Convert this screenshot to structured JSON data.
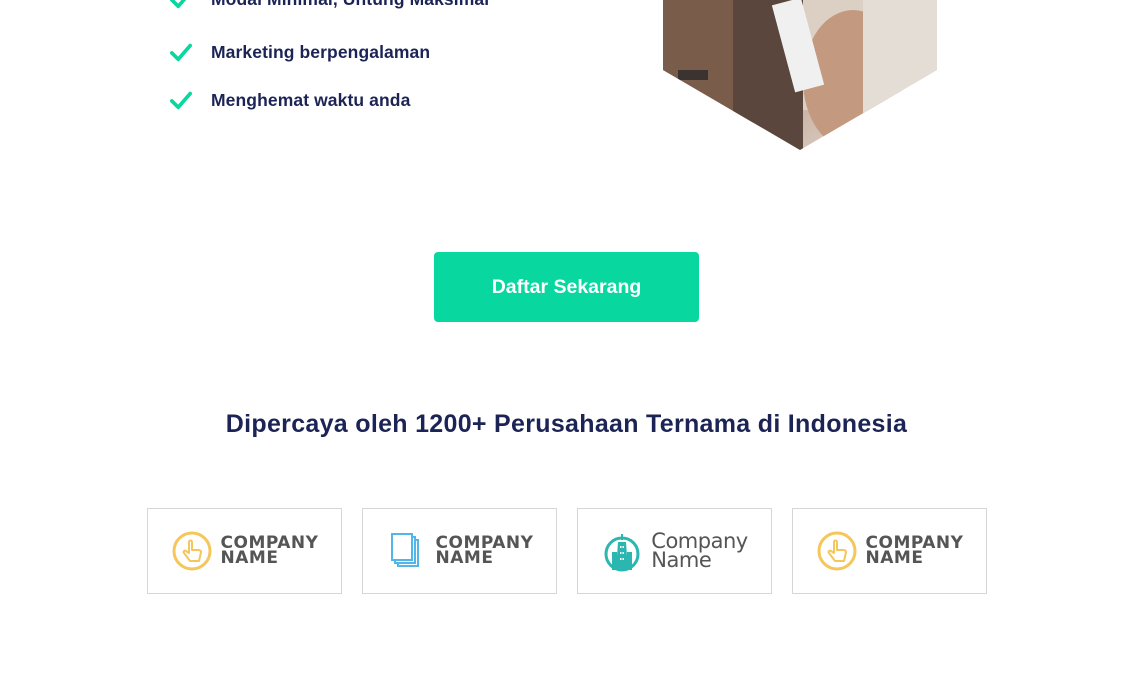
{
  "features": [
    {
      "label": "Modal Minimal, Untung Maksimal",
      "icon": "check-icon"
    },
    {
      "label": "Marketing berpengalaman",
      "icon": "check-icon"
    },
    {
      "label": "Menghemat waktu anda",
      "icon": "check-icon"
    }
  ],
  "hero_image": {
    "icon": "hexagon-photo"
  },
  "cta": {
    "label": "Daftar Sekarang"
  },
  "trust": {
    "title": "Dipercaya oleh 1200+ Perusahaan Ternama di Indonesia"
  },
  "logos": [
    {
      "line1": "COMPANY",
      "line2": "NAME",
      "icon": "pointer-hand-icon"
    },
    {
      "line1": "COMPANY",
      "line2": "NAME",
      "icon": "documents-icon"
    },
    {
      "line1": "Company",
      "line2": "Name",
      "icon": "building-icon"
    },
    {
      "line1": "COMPANY",
      "line2": "NAME",
      "icon": "pointer-hand-icon"
    }
  ],
  "colors": {
    "accent": "#08d89f",
    "heading": "#1c2456",
    "logo_yellow": "#f5c65a",
    "logo_blue": "#52b7e8",
    "logo_teal": "#2bb7b0"
  }
}
